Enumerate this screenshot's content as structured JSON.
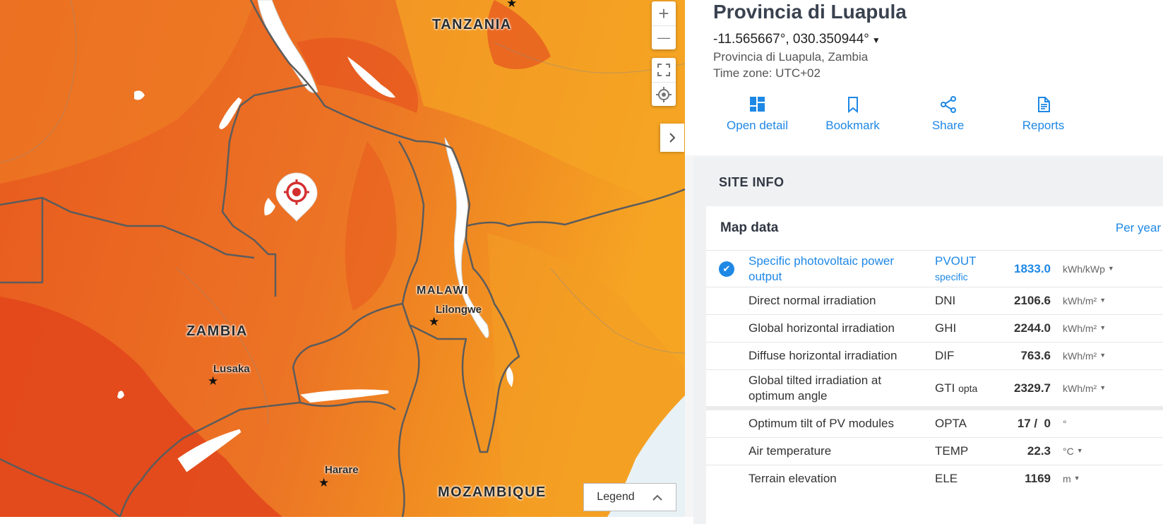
{
  "map": {
    "countries": {
      "tanzania": "TANZANIA",
      "zambia": "ZAMBIA",
      "malawi": "MALAWI",
      "mozambique": "MOZAMBIQUE"
    },
    "cities": {
      "lilongwe": "Lilongwe",
      "lusaka": "Lusaka",
      "harare": "Harare"
    },
    "zoom_in": "+",
    "zoom_out": "—",
    "legend_label": "Legend",
    "colors": {
      "hot": "#e4501c",
      "mid": "#ee7c22",
      "warm": "#f59b21",
      "water": "#ffffff",
      "border": "#5a5a5a"
    }
  },
  "location": {
    "title": "Provincia di Luapula",
    "coordinates": "-11.565667°, 030.350944°",
    "region": "Provincia di Luapula, Zambia",
    "timezone": "Time zone: UTC+02"
  },
  "actions": [
    {
      "label": "Open detail",
      "icon": "dashboard-icon"
    },
    {
      "label": "Bookmark",
      "icon": "bookmark-icon"
    },
    {
      "label": "Share",
      "icon": "share-icon"
    },
    {
      "label": "Reports",
      "icon": "document-icon"
    }
  ],
  "site_info": {
    "title": "SITE INFO",
    "map_data_title": "Map data",
    "period": "Per year",
    "rows": [
      {
        "name": "Specific photovoltaic power output",
        "abbr": "PVOUT",
        "abbr_sub": "specific",
        "value": "1833.0",
        "unit": "kWh/kWp",
        "selected": true
      },
      {
        "name": "Direct normal irradiation",
        "abbr": "DNI",
        "abbr_sub": "",
        "value": "2106.6",
        "unit": "kWh/m²"
      },
      {
        "name": "Global horizontal irradiation",
        "abbr": "GHI",
        "abbr_sub": "",
        "value": "2244.0",
        "unit": "kWh/m²"
      },
      {
        "name": "Diffuse horizontal irradiation",
        "abbr": "DIF",
        "abbr_sub": "",
        "value": "763.6",
        "unit": "kWh/m²"
      },
      {
        "name": "Global tilted irradiation at optimum angle",
        "abbr": "GTI",
        "abbr_sub": "opta",
        "value": "2329.7",
        "unit": "kWh/m²"
      },
      {
        "name": "Optimum tilt of PV modules",
        "abbr": "OPTA",
        "abbr_sub": "",
        "value": "17 /  0",
        "unit": "°"
      },
      {
        "name": "Air temperature",
        "abbr": "TEMP",
        "abbr_sub": "",
        "value": "22.3",
        "unit": "°C"
      },
      {
        "name": "Terrain elevation",
        "abbr": "ELE",
        "abbr_sub": "",
        "value": "1169",
        "unit": "m"
      }
    ]
  }
}
